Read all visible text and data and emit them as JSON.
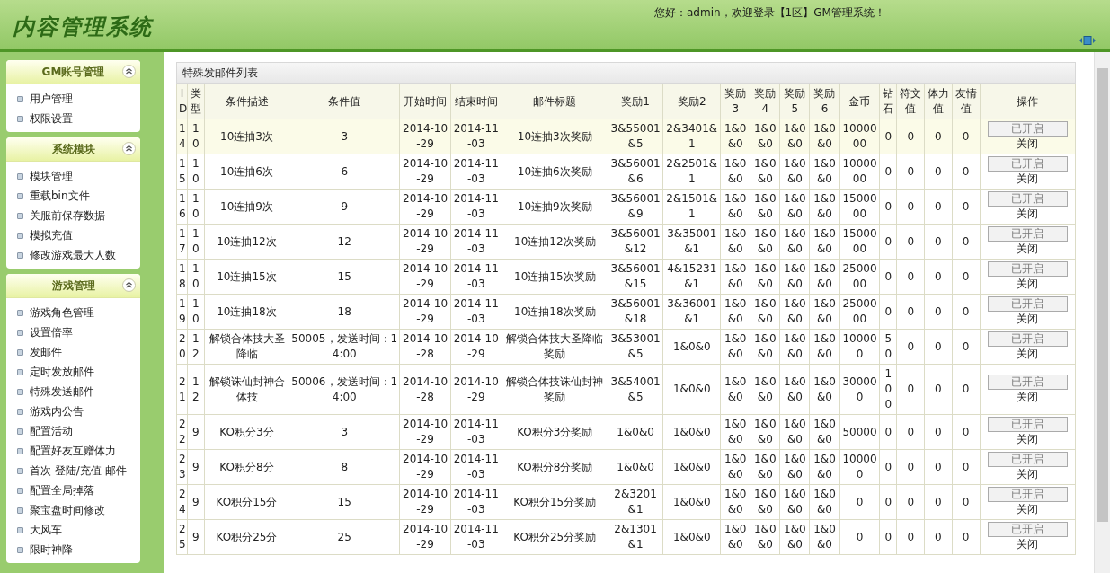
{
  "header": {
    "title": "内容管理系统",
    "greeting": "您好：admin，欢迎登录【1区】GM管理系统！"
  },
  "sidebar": [
    {
      "title": "GM账号管理",
      "expanded": true,
      "items": [
        "用户管理",
        "权限设置"
      ]
    },
    {
      "title": "系统模块",
      "expanded": true,
      "items": [
        "模块管理",
        "重载bin文件",
        "关服前保存数据",
        "模拟充值",
        "修改游戏最大人数"
      ]
    },
    {
      "title": "游戏管理",
      "expanded": true,
      "items": [
        "游戏角色管理",
        "设置倍率",
        "发邮件",
        "定时发放邮件",
        "特殊发送邮件",
        "游戏内公告",
        "配置活动",
        "配置好友互赠体力",
        "首次 登陆/充值 邮件",
        "配置全局掉落",
        "聚宝盘时间修改",
        "大风车",
        "限时神降"
      ]
    }
  ],
  "table": {
    "title": "特殊发邮件列表",
    "columns": [
      "ID",
      "类型",
      "条件描述",
      "条件值",
      "开始时间",
      "结束时间",
      "邮件标题",
      "奖励1",
      "奖励2",
      "奖励3",
      "奖励4",
      "奖励5",
      "奖励6",
      "金币",
      "钻石",
      "符文值",
      "体力值",
      "友情值",
      "操作"
    ],
    "rows": [
      {
        "selected": true,
        "cells": [
          "14",
          "10",
          "10连抽3次",
          "3",
          "2014-10-29",
          "2014-11-03",
          "10连抽3次奖励",
          "3&55001&5",
          "2&3401&1",
          "1&0&0",
          "1&0&0",
          "1&0&0",
          "1&0&0",
          "1000000",
          "0",
          "0",
          "0",
          "0"
        ],
        "status_button": "已开启",
        "close_link": "关闭"
      },
      {
        "selected": false,
        "cells": [
          "15",
          "10",
          "10连抽6次",
          "6",
          "2014-10-29",
          "2014-11-03",
          "10连抽6次奖励",
          "3&56001&6",
          "2&2501&1",
          "1&0&0",
          "1&0&0",
          "1&0&0",
          "1&0&0",
          "1000000",
          "0",
          "0",
          "0",
          "0"
        ],
        "status_button": "已开启",
        "close_link": "关闭"
      },
      {
        "selected": false,
        "cells": [
          "16",
          "10",
          "10连抽9次",
          "9",
          "2014-10-29",
          "2014-11-03",
          "10连抽9次奖励",
          "3&56001&9",
          "2&1501&1",
          "1&0&0",
          "1&0&0",
          "1&0&0",
          "1&0&0",
          "1500000",
          "0",
          "0",
          "0",
          "0"
        ],
        "status_button": "已开启",
        "close_link": "关闭"
      },
      {
        "selected": false,
        "cells": [
          "17",
          "10",
          "10连抽12次",
          "12",
          "2014-10-29",
          "2014-11-03",
          "10连抽12次奖励",
          "3&56001&12",
          "3&35001&1",
          "1&0&0",
          "1&0&0",
          "1&0&0",
          "1&0&0",
          "1500000",
          "0",
          "0",
          "0",
          "0"
        ],
        "status_button": "已开启",
        "close_link": "关闭"
      },
      {
        "selected": false,
        "cells": [
          "18",
          "10",
          "10连抽15次",
          "15",
          "2014-10-29",
          "2014-11-03",
          "10连抽15次奖励",
          "3&56001&15",
          "4&15231&1",
          "1&0&0",
          "1&0&0",
          "1&0&0",
          "1&0&0",
          "2500000",
          "0",
          "0",
          "0",
          "0"
        ],
        "status_button": "已开启",
        "close_link": "关闭"
      },
      {
        "selected": false,
        "cells": [
          "19",
          "10",
          "10连抽18次",
          "18",
          "2014-10-29",
          "2014-11-03",
          "10连抽18次奖励",
          "3&56001&18",
          "3&36001&1",
          "1&0&0",
          "1&0&0",
          "1&0&0",
          "1&0&0",
          "2500000",
          "0",
          "0",
          "0",
          "0"
        ],
        "status_button": "已开启",
        "close_link": "关闭"
      },
      {
        "selected": false,
        "cells": [
          "20",
          "12",
          "解锁合体技大圣降临",
          "50005，发送时间：14:00",
          "2014-10-28",
          "2014-10-29",
          "解锁合体技大圣降临奖励",
          "3&53001&5",
          "1&0&0",
          "1&0&0",
          "1&0&0",
          "1&0&0",
          "1&0&0",
          "100000",
          "50",
          "0",
          "0",
          "0"
        ],
        "status_button": "已开启",
        "close_link": "关闭"
      },
      {
        "selected": false,
        "cells": [
          "21",
          "12",
          "解锁诛仙封神合体技",
          "50006，发送时间：14:00",
          "2014-10-28",
          "2014-10-29",
          "解锁合体技诛仙封神奖励",
          "3&54001&5",
          "1&0&0",
          "1&0&0",
          "1&0&0",
          "1&0&0",
          "1&0&0",
          "300000",
          "100",
          "0",
          "0",
          "0"
        ],
        "status_button": "已开启",
        "close_link": "关闭"
      },
      {
        "selected": false,
        "cells": [
          "22",
          "9",
          "KO积分3分",
          "3",
          "2014-10-29",
          "2014-11-03",
          "KO积分3分奖励",
          "1&0&0",
          "1&0&0",
          "1&0&0",
          "1&0&0",
          "1&0&0",
          "1&0&0",
          "50000",
          "0",
          "0",
          "0",
          "0"
        ],
        "status_button": "已开启",
        "close_link": "关闭"
      },
      {
        "selected": false,
        "cells": [
          "23",
          "9",
          "KO积分8分",
          "8",
          "2014-10-29",
          "2014-11-03",
          "KO积分8分奖励",
          "1&0&0",
          "1&0&0",
          "1&0&0",
          "1&0&0",
          "1&0&0",
          "1&0&0",
          "100000",
          "0",
          "0",
          "0",
          "0"
        ],
        "status_button": "已开启",
        "close_link": "关闭"
      },
      {
        "selected": false,
        "cells": [
          "24",
          "9",
          "KO积分15分",
          "15",
          "2014-10-29",
          "2014-11-03",
          "KO积分15分奖励",
          "2&3201&1",
          "1&0&0",
          "1&0&0",
          "1&0&0",
          "1&0&0",
          "1&0&0",
          "0",
          "0",
          "0",
          "0",
          "0"
        ],
        "status_button": "已开启",
        "close_link": "关闭"
      },
      {
        "selected": false,
        "cells": [
          "25",
          "9",
          "KO积分25分",
          "25",
          "2014-10-29",
          "2014-11-03",
          "KO积分25分奖励",
          "2&1301&1",
          "1&0&0",
          "1&0&0",
          "1&0&0",
          "1&0&0",
          "1&0&0",
          "0",
          "0",
          "0",
          "0",
          "0"
        ],
        "status_button": "已开启",
        "close_link": "关闭"
      }
    ]
  }
}
